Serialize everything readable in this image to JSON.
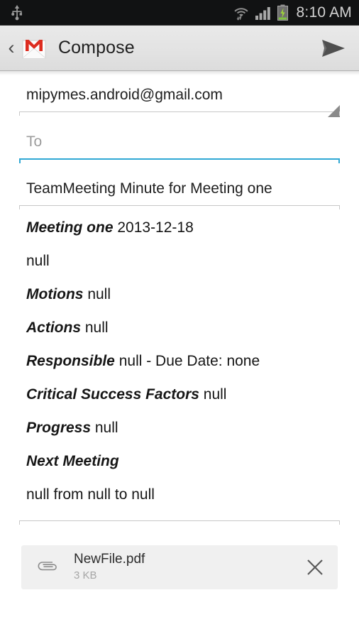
{
  "status_bar": {
    "usb_icon": "usb-icon",
    "wifi_icon": "wifi-icon",
    "signal_icon": "cellular-signal-icon",
    "battery_icon": "battery-charging-icon",
    "time": "8:10 AM",
    "background_color": "#111213",
    "text_color": "#d2d2d2"
  },
  "action_bar": {
    "back_icon": "back-chevron-icon",
    "back_glyph": "‹",
    "app_icon": "gmail-envelope-icon",
    "title": "Compose",
    "send_icon": "send-icon",
    "background_color": "#e3e3e3"
  },
  "compose": {
    "from": {
      "value": "mipymes.android@gmail.com",
      "dropdown_icon": "spinner-triangle-icon"
    },
    "to": {
      "value": "",
      "placeholder": "To",
      "focused": true,
      "accent_color": "#30a8d4"
    },
    "subject": {
      "value": "TeamMeeting Minute for Meeting one",
      "placeholder": "Subject"
    },
    "body_lines": [
      {
        "label": "Meeting one",
        "text": " 2013-12-18"
      },
      {
        "label": "",
        "text": "null"
      },
      {
        "label": "Motions",
        "text": " null"
      },
      {
        "label": "Actions",
        "text": " null"
      },
      {
        "label": "Responsible",
        "text": " null - Due Date: none"
      },
      {
        "label": "Critical Success Factors",
        "text": " null"
      },
      {
        "label": "Progress",
        "text": " null"
      },
      {
        "label": "Next Meeting",
        "text": ""
      },
      {
        "label": "",
        "text": "null from null to null"
      }
    ]
  },
  "attachment": {
    "clip_icon": "paperclip-icon",
    "file_name": "NewFile.pdf",
    "file_size": "3 KB",
    "remove_icon": "close-x-icon",
    "background_color": "#f0f0f0"
  }
}
